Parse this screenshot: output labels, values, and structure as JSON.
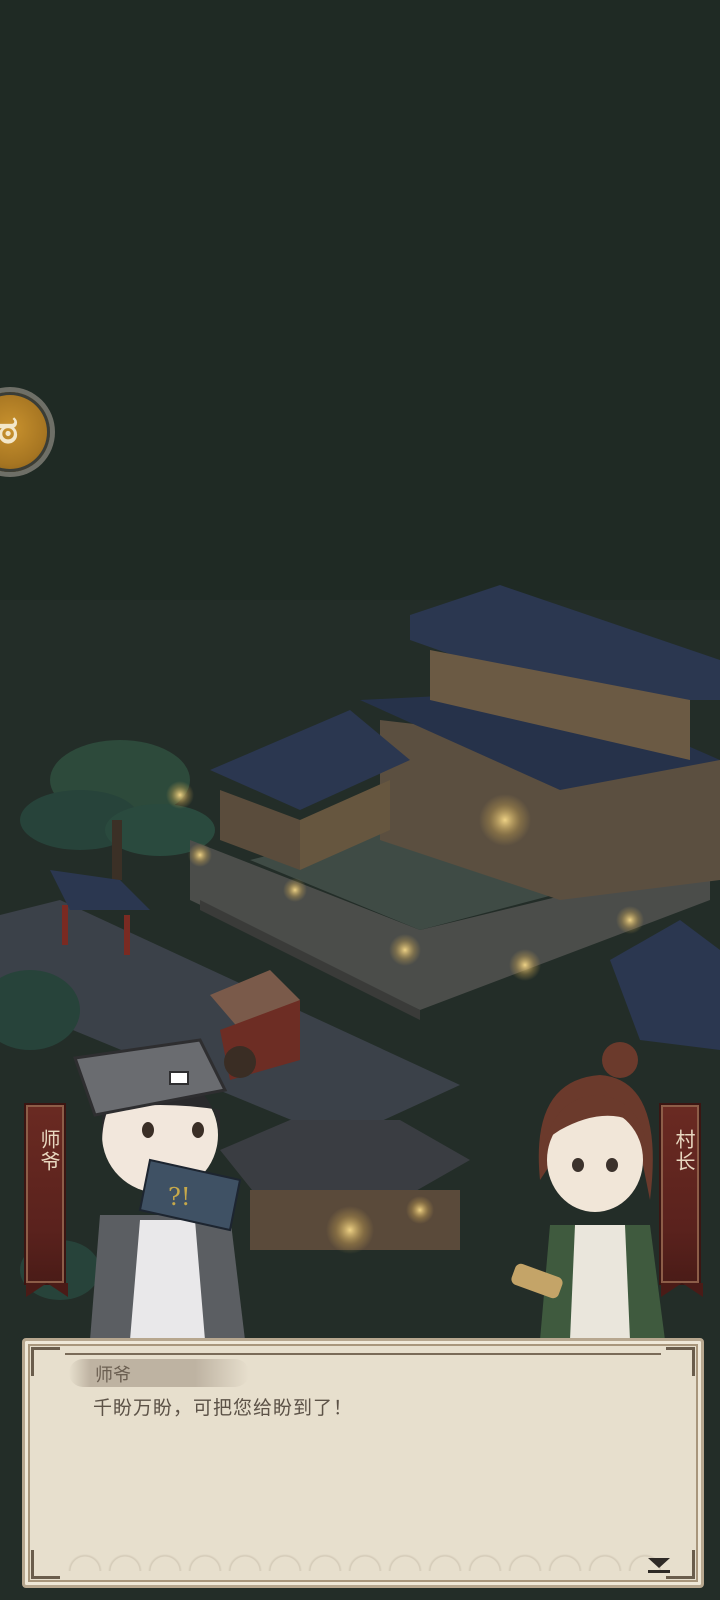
{
  "colors": {
    "night_bg": "#1f2a24",
    "dialog_bg": "#e7dfcd",
    "banner": "#5a221d",
    "side_button": "#b07c25"
  },
  "side_button": {
    "icon": "coin-spiral-icon"
  },
  "characters": {
    "left": {
      "name": "师爷"
    },
    "right": {
      "name": "村长"
    }
  },
  "dialog": {
    "speaker": "师爷",
    "text": "千盼万盼，可把您给盼到了！",
    "next_icon": "next-arrow-icon"
  }
}
